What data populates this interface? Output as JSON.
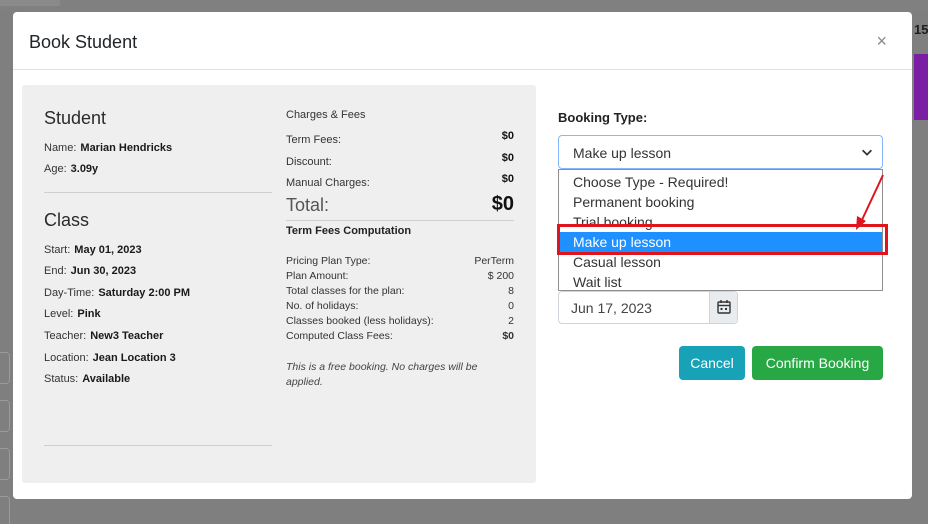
{
  "backdrop": {
    "right_number": "15"
  },
  "modal": {
    "title": "Book Student",
    "close_symbol": "×"
  },
  "student": {
    "heading": "Student",
    "name_label": "Name:",
    "name": "Marian Hendricks",
    "age_label": "Age:",
    "age": "3.09y"
  },
  "class": {
    "heading": "Class",
    "rows": [
      {
        "label": "Start:",
        "value": "May 01, 2023"
      },
      {
        "label": "End:",
        "value": "Jun 30, 2023"
      },
      {
        "label": "Day-Time:",
        "value": "Saturday 2:00 PM"
      },
      {
        "label": "Level:",
        "value": "Pink"
      },
      {
        "label": "Teacher:",
        "value": "New3 Teacher"
      },
      {
        "label": "Location:",
        "value": "Jean Location 3"
      },
      {
        "label": "Status:",
        "value": "Available"
      }
    ]
  },
  "charges": {
    "title": "Charges & Fees",
    "rows": [
      {
        "label": "Term Fees:",
        "value": "$0"
      },
      {
        "label": "Discount:",
        "value": "$0"
      },
      {
        "label": "Manual Charges:",
        "value": "$0"
      }
    ],
    "total_label": "Total:",
    "total_value": "$0"
  },
  "computation": {
    "title": "Term Fees Computation",
    "rows": [
      {
        "label": "Pricing Plan Type:",
        "value": "PerTerm"
      },
      {
        "label": "Plan Amount:",
        "value": "$ 200"
      },
      {
        "label": "Total classes for the plan:",
        "value": "8"
      },
      {
        "label": "No. of holidays:",
        "value": "0"
      },
      {
        "label": "Classes booked (less holidays):",
        "value": "2"
      },
      {
        "label": "Computed Class Fees:",
        "value": "$0"
      }
    ],
    "note": "This is a free booking. No charges will be applied."
  },
  "booking": {
    "label": "Booking Type:",
    "selected": "Make up lesson",
    "options": [
      "Choose Type - Required!",
      "Permanent booking",
      "Trial booking",
      "Make up lesson",
      "Casual lesson",
      "Wait list"
    ],
    "date_value": "Jun 17, 2023"
  },
  "buttons": {
    "cancel": "Cancel",
    "confirm": "Confirm Booking"
  },
  "colors": {
    "highlight": "#1e90ff",
    "annotation": "#e0141c",
    "cancel": "#17a2b8",
    "confirm": "#28a745"
  }
}
